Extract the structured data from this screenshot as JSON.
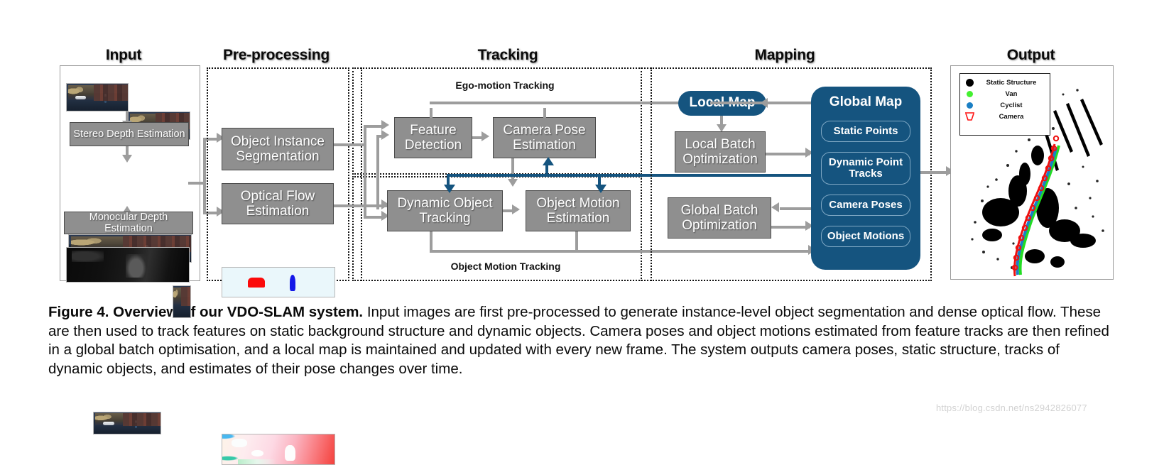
{
  "figure": {
    "caption_bold": "Figure 4.  Overview of our VDO-SLAM system.",
    "caption_rest": " Input images are first pre-processed to generate instance-level object segmentation and dense optical flow. These are then used to track features on static background structure and dynamic objects. Camera poses and object motions estimated from feature tracks are then refined in a global batch optimisation, and a local map is maintained and updated with every new frame. The system outputs camera poses, static structure, tracks of dynamic objects, and estimates of their pose changes over time.",
    "watermark": "https://blog.csdn.net/ns2942826077"
  },
  "sections": {
    "input": "Input",
    "preprocessing": "Pre-processing",
    "tracking": "Tracking",
    "mapping": "Mapping",
    "output": "Output"
  },
  "input_panel": {
    "stereo_box": "Stereo Depth Estimation",
    "mono_box": "Monocular Depth Estimation",
    "thumb_stereo_left": "street-scene-left-image",
    "thumb_stereo_right": "street-scene-right-image",
    "thumb_depth": "depth-map-image",
    "thumb_mono": "street-scene-mono-image"
  },
  "preprocessing_panel": {
    "seg_box": "Object Instance\nSegmentation",
    "seg_box_line1": "Object Instance",
    "seg_box_line2": "Segmentation",
    "flow_box_line1": "Optical Flow",
    "flow_box_line2": "Estimation",
    "thumb_segmentation": "instance-segmentation-image",
    "thumb_flow": "optical-flow-image"
  },
  "tracking_panel": {
    "ego_label": "Ego-motion Tracking",
    "object_label": "Object Motion Tracking",
    "feature_detection_l1": "Feature",
    "feature_detection_l2": "Detection",
    "camera_pose_l1": "Camera Pose",
    "camera_pose_l2": "Estimation",
    "dynamic_object_l1": "Dynamic Object",
    "dynamic_object_l2": "Tracking",
    "object_motion_l1": "Object Motion",
    "object_motion_l2": "Estimation"
  },
  "mapping_panel": {
    "local_map": "Local Map",
    "local_batch_l1": "Local Batch",
    "local_batch_l2": "Optimization",
    "global_batch_l1": "Global Batch",
    "global_batch_l2": "Optimization",
    "global_map": "Global Map",
    "pills": [
      {
        "label": "Static Points"
      },
      {
        "label": "Dynamic Point\nTracks",
        "line1": "Dynamic Point",
        "line2": "Tracks"
      },
      {
        "label": "Camera Poses"
      },
      {
        "label": "Object Motions"
      }
    ]
  },
  "output_panel": {
    "legend": [
      {
        "label": "Static Structure",
        "color": "#000000",
        "shape": "dot"
      },
      {
        "label": "Van",
        "color": "#44f030",
        "shape": "dot"
      },
      {
        "label": "Cyclist",
        "color": "#1b7fc4",
        "shape": "dot"
      },
      {
        "label": "Camera",
        "color": "#ff1111",
        "shape": "camera-frustum"
      }
    ],
    "plot_name": "3d-point-cloud-map"
  },
  "colors": {
    "blue": "#15547f",
    "grey_box": "#8f8f8f",
    "connector": "#9d9d9d"
  }
}
